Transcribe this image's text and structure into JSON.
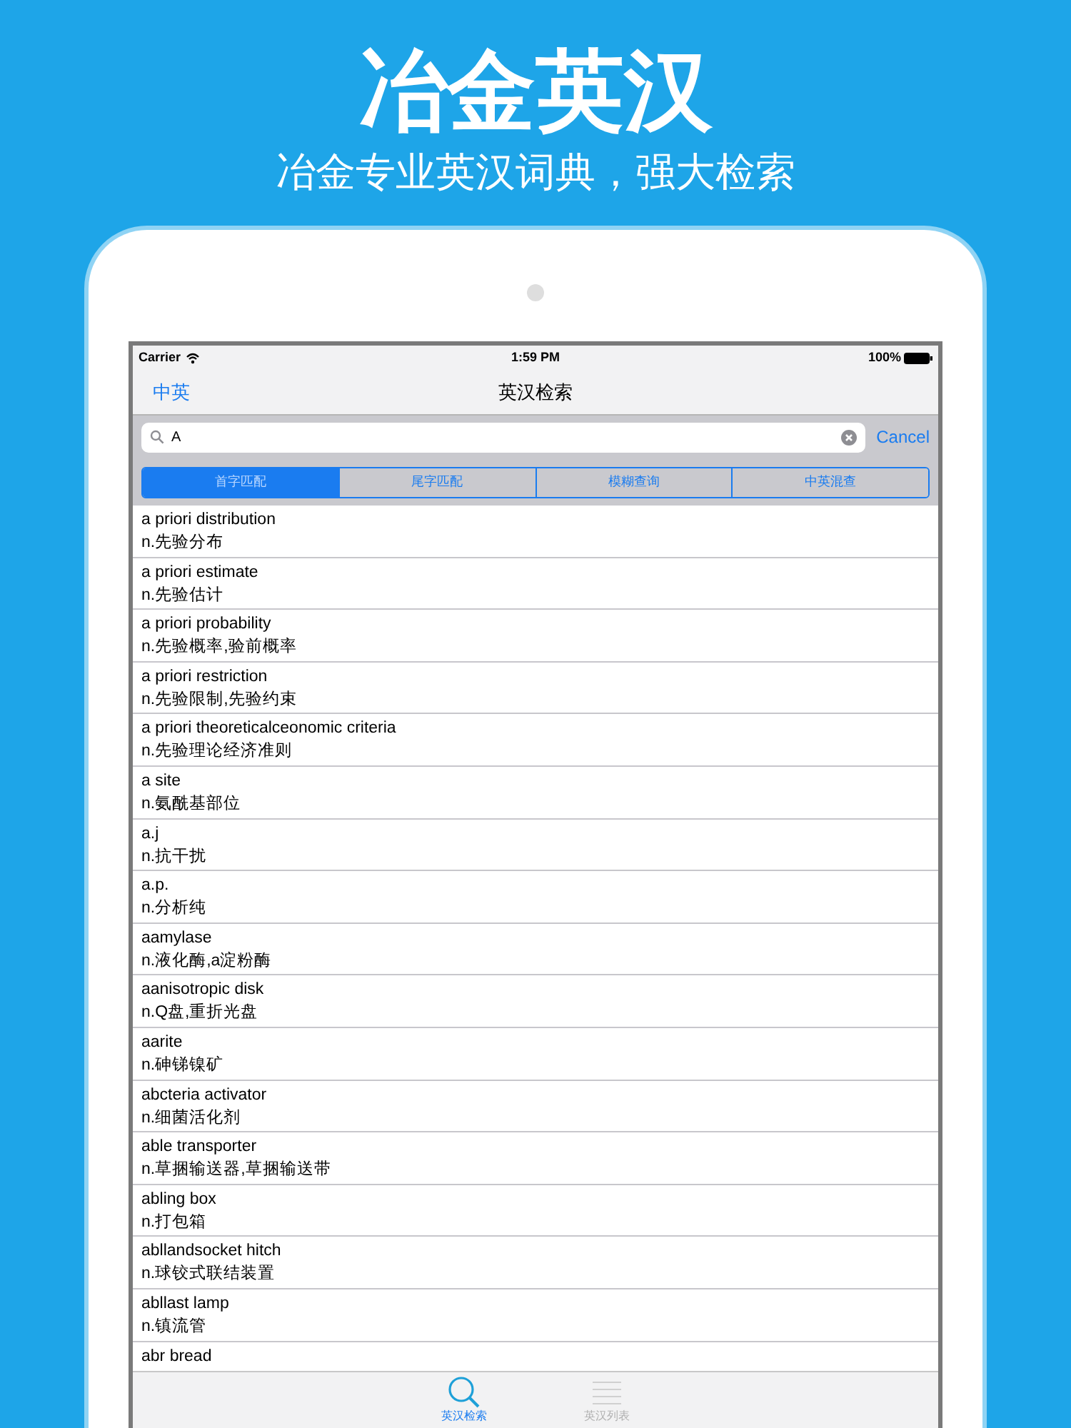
{
  "banner": {
    "title": "冶金英汉",
    "subtitle": "冶金专业英汉词典，强大检索"
  },
  "status_bar": {
    "carrier": "Carrier",
    "time": "1:59 PM",
    "battery": "100%"
  },
  "nav_bar": {
    "left": "中英",
    "title": "英汉检索"
  },
  "search": {
    "value": "A",
    "cancel": "Cancel"
  },
  "segments": [
    {
      "label": "首字匹配",
      "selected": true
    },
    {
      "label": "尾字匹配",
      "selected": false
    },
    {
      "label": "模糊查询",
      "selected": false
    },
    {
      "label": "中英混查",
      "selected": false
    }
  ],
  "entries": [
    {
      "term": "a priori distribution",
      "meaning": "n.先验分布"
    },
    {
      "term": "a priori estimate",
      "meaning": "n.先验估计"
    },
    {
      "term": "a priori probability",
      "meaning": "n.先验概率,验前概率"
    },
    {
      "term": "a priori restriction",
      "meaning": "n.先验限制,先验约束"
    },
    {
      "term": "a priori theoreticalceonomic criteria",
      "meaning": "n.先验理论经济准则"
    },
    {
      "term": "a site",
      "meaning": "n.氨酰基部位"
    },
    {
      "term": "a.j",
      "meaning": "n.抗干扰"
    },
    {
      "term": "a.p.",
      "meaning": "n.分析纯"
    },
    {
      "term": "aamylase",
      "meaning": "n.液化酶,a淀粉酶"
    },
    {
      "term": "aanisotropic disk",
      "meaning": "n.Q盘,重折光盘"
    },
    {
      "term": "aarite",
      "meaning": "n.砷锑镍矿"
    },
    {
      "term": "abcteria activator",
      "meaning": "n.细菌活化剂"
    },
    {
      "term": "able transporter",
      "meaning": "n.草捆输送器,草捆输送带"
    },
    {
      "term": "abling box",
      "meaning": "n.打包箱"
    },
    {
      "term": "abllandsocket hitch",
      "meaning": "n.球铰式联结装置"
    },
    {
      "term": "abllast lamp",
      "meaning": "n.镇流管"
    },
    {
      "term": "abr bread"
    }
  ],
  "tab_bar": [
    {
      "label": "英汉检索",
      "kind": "search",
      "selected": true
    },
    {
      "label": "英汉列表",
      "kind": "list",
      "selected": false
    }
  ]
}
